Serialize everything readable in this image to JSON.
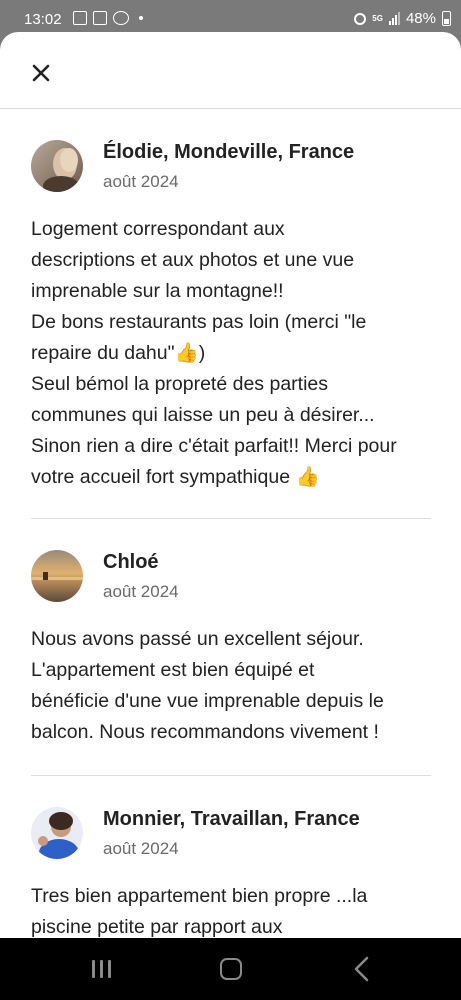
{
  "status_bar": {
    "time": "13:02",
    "network": "5G",
    "battery": "48%"
  },
  "header": {
    "close_icon": "close-icon"
  },
  "reviews": [
    {
      "name": "Élodie, Mondeville, France",
      "date": "août 2024",
      "text": "Logement correspondant aux\ndescriptions et aux photos et une vue\nimprenable sur la montagne!!\nDe bons restaurants pas loin (merci \"le\nrepaire du dahu\"👍)\nSeul bémol la propreté des parties\ncommunes qui laisse un peu à désirer...\nSinon rien a dire c'était parfait!! Merci pour\nvotre accueil fort sympathique 👍"
    },
    {
      "name": "Chloé",
      "date": "août 2024",
      "text": "Nous avons passé un excellent séjour.\nL'appartement est bien équipé et\nbénéficie d'une vue imprenable depuis le\nbalcon. Nous recommandons vivement !"
    },
    {
      "name": "Monnier, Travaillan, France",
      "date": "août 2024",
      "text": "Tres bien appartement bien propre ...la\npiscine petite par rapport aux"
    }
  ],
  "colors": {
    "text_primary": "#222222",
    "text_secondary": "#6a6a6a",
    "divider": "#dddddd"
  }
}
